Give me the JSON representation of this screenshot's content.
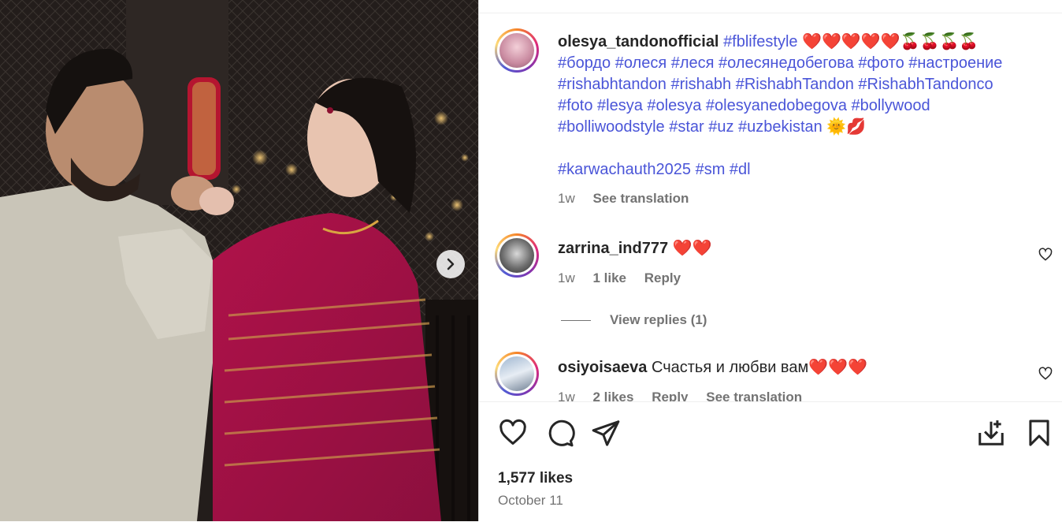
{
  "post": {
    "username": "olesya_tandonofficial",
    "caption_line1_tag": "#fblifestyle",
    "caption_line1_emoji": "❤️❤️❤️❤️❤️🍒🍒🍒🍒",
    "caption_line2": "#бордо #олеся #леся #олесянедобегова #фото #настроение",
    "caption_line3": "#rishabhtandon #rishabh #RishabhTandon #RishabhTandonco",
    "caption_line4": "#foto #lesya #olesya #olesyanedobegova #bollywood",
    "caption_line5_tags": "#bolliwoodstyle #star #uz #uzbekistan",
    "caption_line5_emoji": "🌞💋",
    "caption_line6": "#karwachauth2025 #sm #dl",
    "time": "1w",
    "see_translation": "See translation"
  },
  "comments": [
    {
      "username": "zarrina_ind777",
      "text": "❤️❤️",
      "time": "1w",
      "likes": "1 like",
      "reply": "Reply",
      "view_replies": "View replies (1)"
    },
    {
      "username": "osiyoisaeva",
      "text": "Счастья и любви вам",
      "emoji": "❤️❤️❤️",
      "time": "1w",
      "likes": "2 likes",
      "reply": "Reply",
      "see_translation": "See translation"
    }
  ],
  "footer": {
    "likes": "1,577 likes",
    "date": "October 11"
  },
  "icons": [
    "heart-icon",
    "comment-icon",
    "share-icon",
    "save-to-collection-icon",
    "bookmark-icon",
    "chevron-right-icon"
  ],
  "colors": {
    "hashtag": "#4a55d8",
    "secondary_text": "#737373",
    "heart": "#e0245e"
  }
}
